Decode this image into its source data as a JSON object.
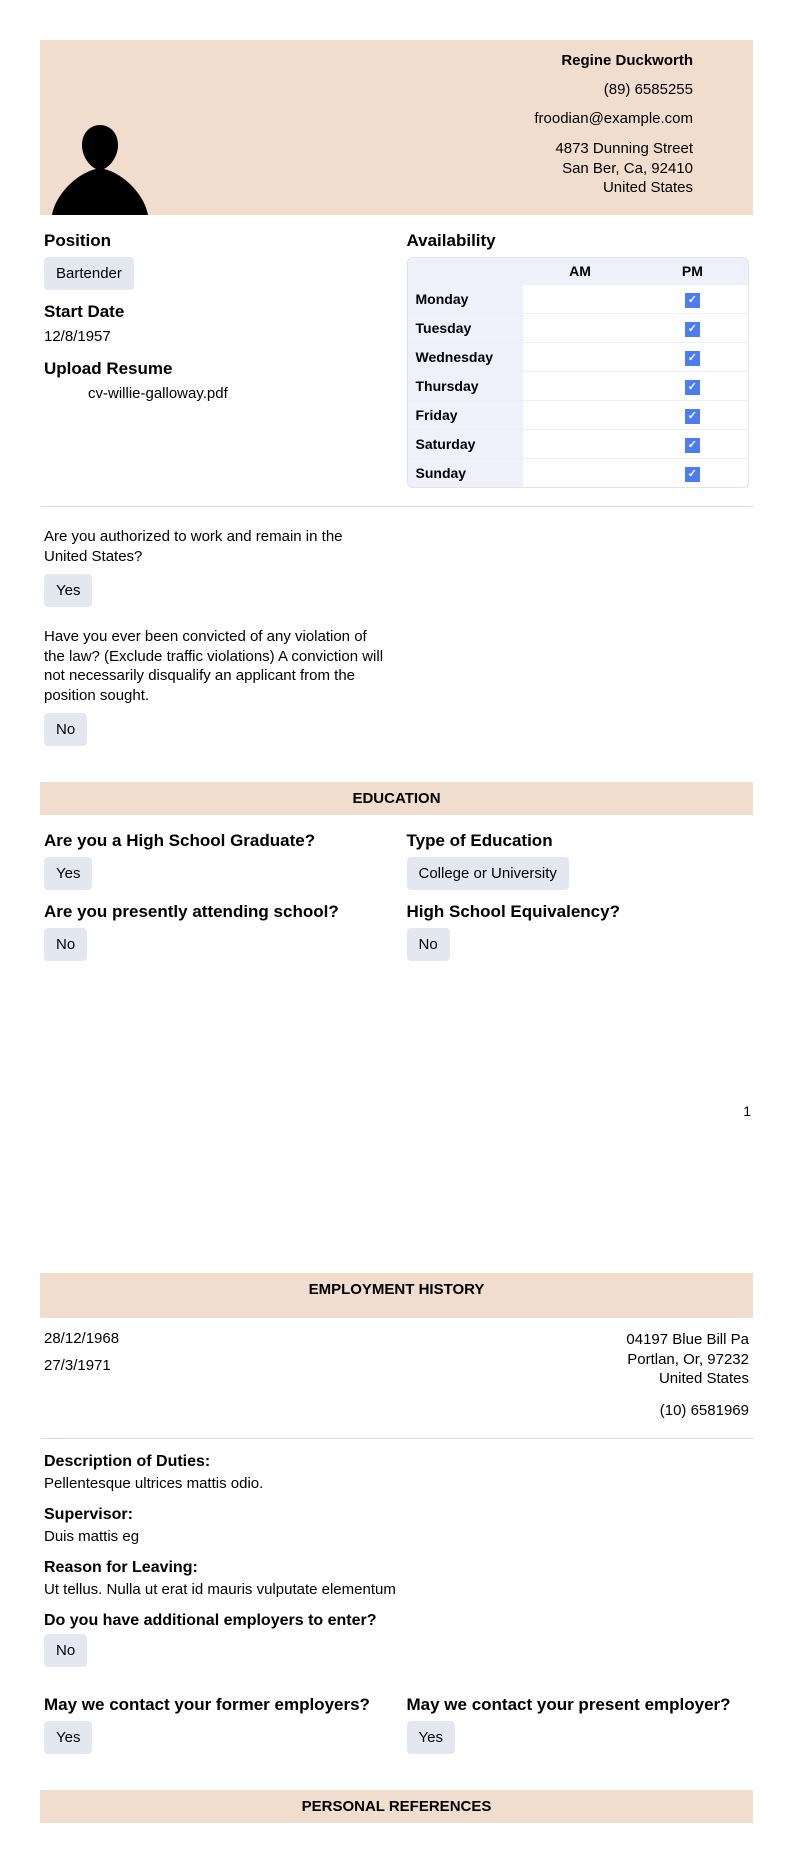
{
  "header": {
    "name": "Regine Duckworth",
    "phone": "(89) 6585255",
    "email": "froodian@example.com",
    "addr1": "4873 Dunning Street",
    "addr2": "San Ber, Ca, 92410",
    "addr3": "United States"
  },
  "position": {
    "label": "Position",
    "value": "Bartender",
    "start_label": "Start Date",
    "start_value": "12/8/1957",
    "upload_label": "Upload Resume",
    "upload_value": "cv-willie-galloway.pdf"
  },
  "availability": {
    "label": "Availability",
    "am": "AM",
    "pm": "PM",
    "days": [
      "Monday",
      "Tuesday",
      "Wednesday",
      "Thursday",
      "Friday",
      "Saturday",
      "Sunday"
    ]
  },
  "q_auth": {
    "text": "Are you authorized to work and remain in the United States?",
    "value": "Yes"
  },
  "q_conv": {
    "text": "Have you ever been convicted of any violation of the law? (Exclude traffic violations) A conviction will not necessarily disqualify an applicant from the position sought.",
    "value": "No"
  },
  "education": {
    "bar": "EDUCATION",
    "q_hs": {
      "label": "Are you a High School Graduate?",
      "value": "Yes"
    },
    "q_type": {
      "label": "Type of Education",
      "value": "College or University"
    },
    "q_attend": {
      "label": "Are you presently attending school?",
      "value": "No"
    },
    "q_equiv": {
      "label": "High School Equivalency?",
      "value": "No"
    }
  },
  "page_number": "1",
  "employment": {
    "bar": "EMPLOYMENT HISTORY",
    "date1": "28/12/1968",
    "date2": "27/3/1971",
    "addr1": "04197 Blue Bill Pa",
    "addr2": "Portlan, Or, 97232",
    "addr3": "United States",
    "phone": "(10) 6581969",
    "duties_label": "Description of Duties:",
    "duties_value": "Pellentesque ultrices mattis odio.",
    "super_label": "Supervisor:",
    "super_value": "Duis mattis eg",
    "reason_label": "Reason for Leaving:",
    "reason_value": "Ut tellus. Nulla ut erat id mauris vulputate elementum",
    "q_more": {
      "label": "Do you have additional employers to enter?",
      "value": "No"
    },
    "q_former": {
      "label": "May we contact your former employers?",
      "value": "Yes"
    },
    "q_present": {
      "label": "May we contact your present employer?",
      "value": "Yes"
    }
  },
  "references": {
    "bar": "PERSONAL REFERENCES"
  }
}
